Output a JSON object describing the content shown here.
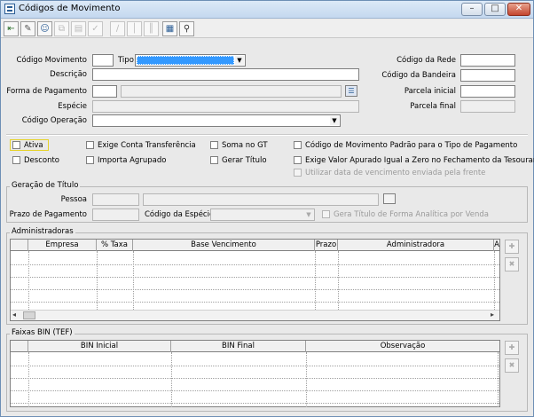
{
  "window": {
    "title": "Códigos de Movimento",
    "buttons": [
      "minimize",
      "maximize",
      "close"
    ]
  },
  "toolbar": {
    "buttons": [
      {
        "icon": "exit-icon",
        "enabled": true
      },
      {
        "icon": "edit-icon",
        "enabled": true
      },
      {
        "icon": "users-icon",
        "enabled": true
      },
      {
        "icon": "copy-icon",
        "enabled": false
      },
      {
        "icon": "paste-icon",
        "enabled": false
      },
      {
        "icon": "check-icon",
        "enabled": false
      },
      {
        "icon": "pencil-icon",
        "enabled": false
      },
      {
        "icon": "separator-icon",
        "enabled": false
      },
      {
        "icon": "columns-icon",
        "enabled": false
      },
      {
        "icon": "grid-icon",
        "enabled": true
      },
      {
        "icon": "binoculars-icon",
        "enabled": true
      }
    ]
  },
  "form": {
    "codigo_movimento_label": "Código Movimento",
    "tipo_label": "Tipo",
    "descricao_label": "Descrição",
    "forma_pagamento_label": "Forma de Pagamento",
    "especie_label": "Espécie",
    "codigo_operacao_label": "Código Operação",
    "codigo_rede_label": "Código da Rede",
    "codigo_bandeira_label": "Código da Bandeira",
    "parcela_inicial_label": "Parcela inicial",
    "parcela_final_label": "Parcela final"
  },
  "checkboxes": {
    "ativa": "Ativa",
    "desconto": "Desconto",
    "exige_conta": "Exige Conta Transferência",
    "importa_agrupado": "Importa Agrupado",
    "soma_gt": "Soma no GT",
    "gerar_titulo": "Gerar Título",
    "codigo_padrao": "Código de Movimento Padrão para o Tipo de Pagamento",
    "exige_valor": "Exige Valor Apurado Igual a Zero no Fechamento da Tesouraria",
    "utilizar_data": "Utilizar data de vencimento enviada pela frente"
  },
  "geracao_titulo": {
    "title": "Geração de Título",
    "pessoa_label": "Pessoa",
    "prazo_label": "Prazo de Pagamento",
    "codigo_especie_label": "Código da Espécie",
    "gera_titulo_label": "Gera Título de Forma Analítica por Venda"
  },
  "administradoras": {
    "title": "Administradoras",
    "columns": [
      "Empresa",
      "% Taxa",
      "Base Vencimento",
      "Prazo",
      "Administradora",
      "A"
    ],
    "rows": []
  },
  "faixas_bin": {
    "title": "Faixas BIN (TEF)",
    "columns": [
      "BIN Inicial",
      "BIN Final",
      "Observação"
    ],
    "rows": []
  },
  "colors": {
    "selection_blue": "#3399ff",
    "window_bg": "#e9e9e9",
    "focus_border": "#e6d22a"
  }
}
